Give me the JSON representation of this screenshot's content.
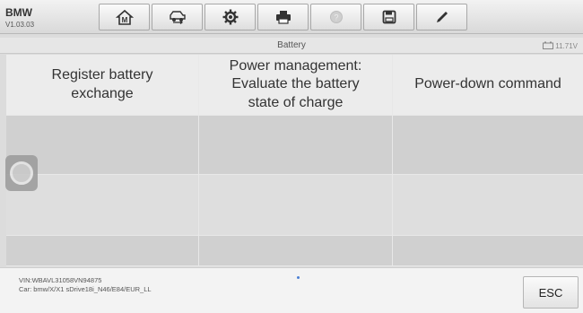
{
  "app": {
    "name": "BMW",
    "version": "V1.03.03"
  },
  "toolbar": [
    {
      "name": "home-button",
      "icon": "home-icon"
    },
    {
      "name": "vehicle-swap-button",
      "icon": "car-swap-icon"
    },
    {
      "name": "settings-button",
      "icon": "gear-icon"
    },
    {
      "name": "print-button",
      "icon": "printer-icon"
    },
    {
      "name": "help-button",
      "icon": "help-icon",
      "disabled": true
    },
    {
      "name": "save-button",
      "icon": "save-icon"
    },
    {
      "name": "notes-button",
      "icon": "pen-icon"
    }
  ],
  "subbar": {
    "title": "Battery",
    "voltage": "11.71V"
  },
  "menu": {
    "columns": [
      "Register battery\nexchange",
      "Power management:\nEvaluate the battery\nstate of charge",
      "Power-down command"
    ]
  },
  "footer": {
    "vin": "VIN:WBAVL31058VN94875",
    "car": "Car: bmw/X/X1 sDrive18i_N46/E84/EUR_LL",
    "esc_label": "ESC"
  },
  "colors": {
    "accent_dot": "#4b7fd4",
    "row_dark": "#d0d0d0",
    "row_light": "#dedede"
  }
}
